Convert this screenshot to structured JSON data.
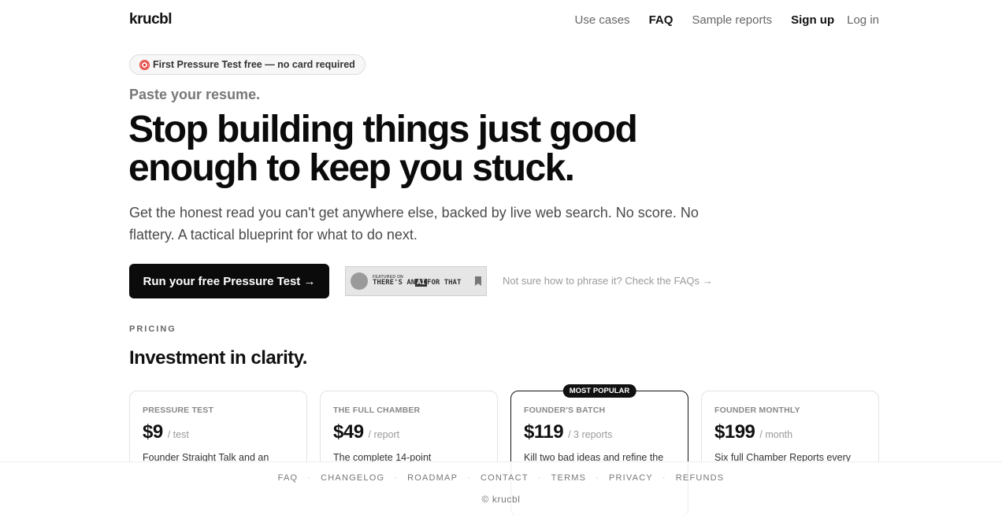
{
  "nav": {
    "logo": "krucbl",
    "links": [
      "Use cases",
      "FAQ",
      "Sample reports"
    ],
    "signup": "Sign up",
    "login": "Log in"
  },
  "hero": {
    "badge": "First Pressure Test free — no card required",
    "kicker": "Paste your resume.",
    "headline": "Stop building things just good enough to keep you stuck.",
    "sub": "Get the honest read you can't get anywhere else, backed by live web search. No score. No flattery. A tactical blueprint for what to do next.",
    "cta": "Run your free Pressure Test →",
    "featured_small": "FEATURED ON",
    "featured_pre": "THERE'S AN",
    "featured_ai": "AI",
    "featured_post": "FOR THAT",
    "faq_hint": "Not sure how to phrase it? Check the FAQs →"
  },
  "pricing": {
    "label": "PRICING",
    "title": "Investment in clarity.",
    "popular_badge": "MOST POPULAR",
    "plans": [
      {
        "name": "PRESSURE TEST",
        "price": "$9",
        "unit": "/ test",
        "desc": "Founder Straight Talk and an"
      },
      {
        "name": "THE FULL CHAMBER",
        "price": "$49",
        "unit": "/ report",
        "desc": "The complete 14-point"
      },
      {
        "name": "FOUNDER'S BATCH",
        "price": "$119",
        "unit": "/ 3 reports",
        "desc": "Kill two bad ideas and refine the"
      },
      {
        "name": "FOUNDER MONTHLY",
        "price": "$199",
        "unit": "/ month",
        "desc": "Six full Chamber Reports every"
      }
    ]
  },
  "footer": {
    "links": [
      "FAQ",
      "CHANGELOG",
      "ROADMAP",
      "CONTACT",
      "TERMS",
      "PRIVACY",
      "REFUNDS"
    ],
    "separator": "·",
    "copyright": "© krucbl"
  }
}
